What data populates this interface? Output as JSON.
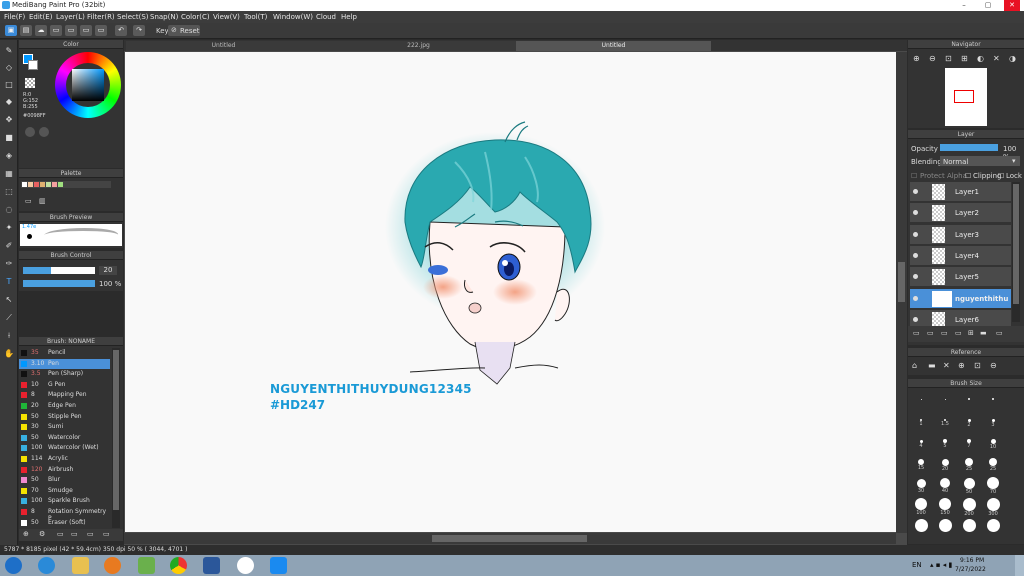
{
  "window": {
    "title": "MediBang Paint Pro (32bit)"
  },
  "menu": [
    "File(F)",
    "Edit(E)",
    "Layer(L)",
    "Filter(R)",
    "Select(S)",
    "Snap(N)",
    "Color(C)",
    "View(V)",
    "Tool(T)",
    "Window(W)",
    "Cloud",
    "Help"
  ],
  "toolbar": {
    "key_label": "Key",
    "reset_label": "Reset"
  },
  "tabs": [
    "Untitled",
    "222.jpg",
    "Untitled"
  ],
  "color_panel": {
    "title": "Color",
    "r": "R:0",
    "g": "G:152",
    "b": "B:255",
    "hex": "#0098FF"
  },
  "palette_panel": {
    "title": "Palette"
  },
  "brush_preview": {
    "title": "Brush Preview",
    "size": "1.47e"
  },
  "brush_control": {
    "title": "Brush Control",
    "size_value": "20",
    "opacity_value": "100 %"
  },
  "brush_list": {
    "title": "Brush: NONAME",
    "items": [
      {
        "size": "35",
        "name": "Pencil",
        "color": "#111111"
      },
      {
        "size": "3.10",
        "name": "Pen",
        "color": "#0098ff",
        "selected": true
      },
      {
        "size": "3.5",
        "name": "Pen (Sharp)",
        "color": "#111111"
      },
      {
        "size": "10",
        "name": "G Pen",
        "color": "#e8212e"
      },
      {
        "size": "8",
        "name": "Mapping Pen",
        "color": "#e8212e"
      },
      {
        "size": "20",
        "name": "Edge Pen",
        "color": "#1fb538"
      },
      {
        "size": "50",
        "name": "Stipple Pen",
        "color": "#f5e200"
      },
      {
        "size": "30",
        "name": "Sumi",
        "color": "#f5e200"
      },
      {
        "size": "50",
        "name": "Watercolor",
        "color": "#38b0e0"
      },
      {
        "size": "100",
        "name": "Watercolor (Wet)",
        "color": "#38b0e0"
      },
      {
        "size": "114",
        "name": "Acrylic",
        "color": "#f5e200"
      },
      {
        "size": "120",
        "name": "Airbrush",
        "color": "#e8212e"
      },
      {
        "size": "50",
        "name": "Blur",
        "color": "#f08ad0"
      },
      {
        "size": "70",
        "name": "Smudge",
        "color": "#f5e200"
      },
      {
        "size": "100",
        "name": "Sparkle Brush",
        "color": "#38b0e0"
      },
      {
        "size": "8",
        "name": "Rotation Symmetry P",
        "color": "#e8212e"
      },
      {
        "size": "50",
        "name": "Eraser (Soft)",
        "color": "#ffffff"
      }
    ]
  },
  "navigator": {
    "title": "Navigator"
  },
  "layer_panel": {
    "title": "Layer",
    "opacity_label": "Opacity",
    "opacity_value": "100 %",
    "blending_label": "Blending",
    "blending_value": "Normal",
    "protect_alpha": "Protect Alpha",
    "clipping": "Clipping",
    "lock": "Lock",
    "layers": [
      "Layer1",
      "Layer2",
      "Layer3",
      "Layer4",
      "Layer5",
      "nguyenthithu",
      "Layer6"
    ]
  },
  "reference": {
    "title": "Reference"
  },
  "brush_size": {
    "title": "Brush Size",
    "rows": [
      [
        "",
        "",
        "",
        ""
      ],
      [
        "1",
        "1.5",
        "2",
        "3"
      ],
      [
        "4",
        "5",
        "7",
        "10"
      ],
      [
        "15",
        "20",
        "25",
        "25"
      ],
      [
        "30",
        "40",
        "50",
        "70"
      ],
      [
        "100",
        "150",
        "200",
        "300"
      ],
      [
        "",
        "",
        "",
        ""
      ]
    ]
  },
  "canvas_text": {
    "line1": "NGUYENTHITHUYDUNG12345",
    "line2": "#HD247"
  },
  "status": {
    "text": "5787 * 8185 pixel  (42 * 59.4cm)  350 dpi  50 %  ( 3044, 4701 )"
  },
  "taskbar": {
    "lang": "EN",
    "time": "9:16 PM",
    "date": "7/27/2022"
  },
  "colors": {
    "accent": "#0098ff",
    "text_blue": "#1a9ad6",
    "hair": "#2aa9b0"
  }
}
